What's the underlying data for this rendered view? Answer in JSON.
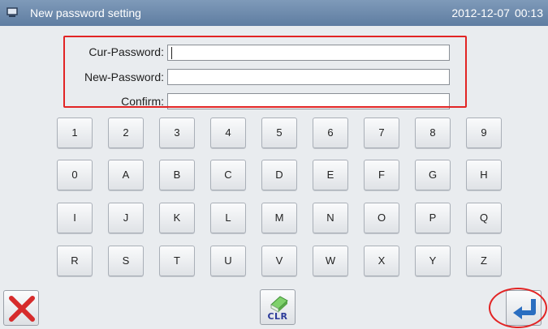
{
  "titlebar": {
    "title": "New password setting",
    "date": "2012-12-07",
    "time": "00:13",
    "icon": "monitor-icon"
  },
  "form": {
    "fields": [
      {
        "label": "Cur-Password",
        "value": ""
      },
      {
        "label": "New-Password",
        "value": ""
      },
      {
        "label": "Confirm",
        "value": ""
      }
    ]
  },
  "keypad": {
    "rows": [
      [
        "1",
        "2",
        "3",
        "4",
        "5",
        "6",
        "7",
        "8",
        "9"
      ],
      [
        "0",
        "A",
        "B",
        "C",
        "D",
        "E",
        "F",
        "G",
        "H"
      ],
      [
        "I",
        "J",
        "K",
        "L",
        "M",
        "N",
        "O",
        "P",
        "Q"
      ],
      [
        "R",
        "S",
        "T",
        "U",
        "V",
        "W",
        "X",
        "Y",
        "Z"
      ]
    ]
  },
  "actions": {
    "cancel_icon": "close-icon",
    "clear_label": "CLR",
    "clear_icon": "eraser-icon",
    "enter_icon": "enter-arrow-icon"
  },
  "colors": {
    "titlebar": "#6e8aae",
    "highlight": "#e22424",
    "cancel": "#d62b2b",
    "enter": "#2a6ec0",
    "clear_text": "#2b3a99"
  }
}
